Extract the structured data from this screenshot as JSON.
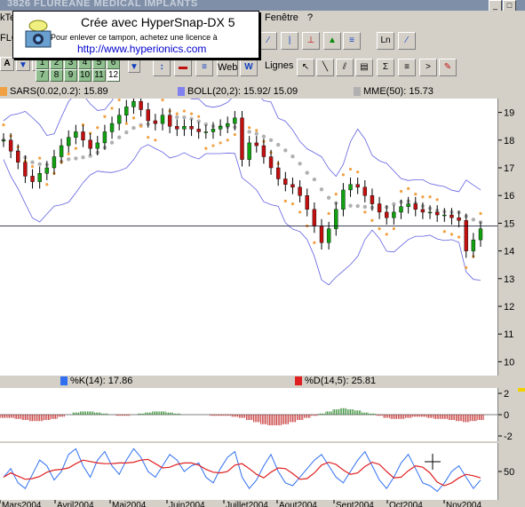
{
  "window": {
    "title": "3826  FLUREANE MEDICAL IMPLANTS"
  },
  "menu": {
    "left_fragment": "kTe",
    "window_menu": "Fenêtre",
    "help_menu": "?"
  },
  "toolbar": {
    "symbol": "FLO",
    "scale_a": "A",
    "periods_row1": [
      "1",
      "2",
      "3",
      "4",
      "5",
      "6"
    ],
    "periods_row2": [
      "7",
      "8",
      "9",
      "10",
      "11",
      "12"
    ],
    "web_label": "Web",
    "lines_label": "Lignes"
  },
  "watermark": {
    "line1": "Crée avec HyperSnap-DX 5",
    "line2": "Pour enlever ce tampon, achetez une licence à",
    "line3": "http://www.hyperionics.com"
  },
  "legend": {
    "sars": "SARS(0.02,0.2): 15.89",
    "sars_color": "#f0a040",
    "boll": "BOLL(20,2): 15.92/ 15.09",
    "boll_color": "#8080f0",
    "mme": "MME(50): 15.73",
    "mme_color": "#b0b0b0"
  },
  "legend2": {
    "k": "%K(14): 17.86",
    "k_color": "#3070f0",
    "d": "%D(14,5): 25.81",
    "d_color": "#e02020"
  },
  "axes": {
    "price_ticks": [
      "19",
      "18",
      "17",
      "16",
      "15",
      "14",
      "13",
      "12",
      "11",
      "10"
    ],
    "osc_ticks": [
      "2",
      "0",
      "-2"
    ],
    "stoch_ticks": [
      "50"
    ],
    "months": [
      "Mars2004",
      "Avril2004",
      "Mai2004",
      "Juin2004",
      "Juillet2004",
      "Aout2004",
      "Sept2004",
      "Oct2004",
      "Nov2004"
    ]
  },
  "chart_data": {
    "type": "candlestick",
    "ylim": [
      9.5,
      19.5
    ],
    "current_price_line": 14.9,
    "close": [
      18.0,
      17.6,
      17.2,
      16.7,
      16.5,
      16.8,
      17.0,
      17.4,
      17.8,
      18.1,
      18.3,
      18.0,
      17.7,
      17.9,
      18.3,
      18.6,
      18.9,
      19.2,
      19.4,
      19.1,
      18.7,
      18.6,
      18.9,
      18.5,
      18.4,
      18.5,
      18.4,
      18.3,
      18.3,
      18.4,
      18.5,
      18.6,
      18.8,
      17.3,
      17.9,
      17.8,
      17.4,
      17.0,
      16.6,
      16.4,
      16.3,
      16.0,
      15.5,
      14.9,
      14.3,
      14.8,
      15.5,
      16.2,
      16.4,
      16.3,
      16.0,
      15.7,
      15.4,
      15.2,
      15.4,
      15.6,
      15.7,
      15.5,
      15.4,
      15.4,
      15.3,
      15.3,
      15.2,
      15.1,
      14.0,
      14.4,
      14.8
    ],
    "macd_hist": [
      -0.3,
      -0.3,
      -0.4,
      -0.5,
      -0.6,
      -0.6,
      -0.5,
      -0.4,
      -0.2,
      0.0,
      0.2,
      0.3,
      0.3,
      0.2,
      0.1,
      0.0,
      -0.1,
      -0.1,
      0.0,
      0.1,
      0.2,
      0.3,
      0.3,
      0.2,
      0.1,
      0.0,
      0.0,
      0.0,
      0.0,
      -0.1,
      -0.1,
      -0.1,
      -0.2,
      -0.3,
      -0.5,
      -0.7,
      -0.9,
      -1.0,
      -1.0,
      -0.9,
      -0.7,
      -0.5,
      -0.3,
      -0.1,
      0.1,
      0.3,
      0.5,
      0.6,
      0.5,
      0.4,
      0.2,
      0.1,
      -0.1,
      -0.3,
      -0.4,
      -0.4,
      -0.3,
      -0.2,
      -0.2,
      -0.3,
      -0.4,
      -0.4,
      -0.5,
      -0.6,
      -0.7,
      -0.6,
      -0.5
    ],
    "stoch_k": [
      40,
      55,
      30,
      20,
      45,
      70,
      60,
      35,
      50,
      80,
      90,
      60,
      40,
      70,
      85,
      60,
      45,
      70,
      90,
      75,
      50,
      40,
      60,
      80,
      70,
      50,
      60,
      65,
      40,
      30,
      55,
      75,
      85,
      40,
      20,
      35,
      60,
      80,
      50,
      30,
      25,
      40,
      55,
      70,
      80,
      60,
      40,
      30,
      50,
      70,
      85,
      60,
      35,
      20,
      40,
      65,
      80,
      55,
      30,
      25,
      15,
      30,
      50,
      60,
      40,
      20,
      35
    ]
  }
}
